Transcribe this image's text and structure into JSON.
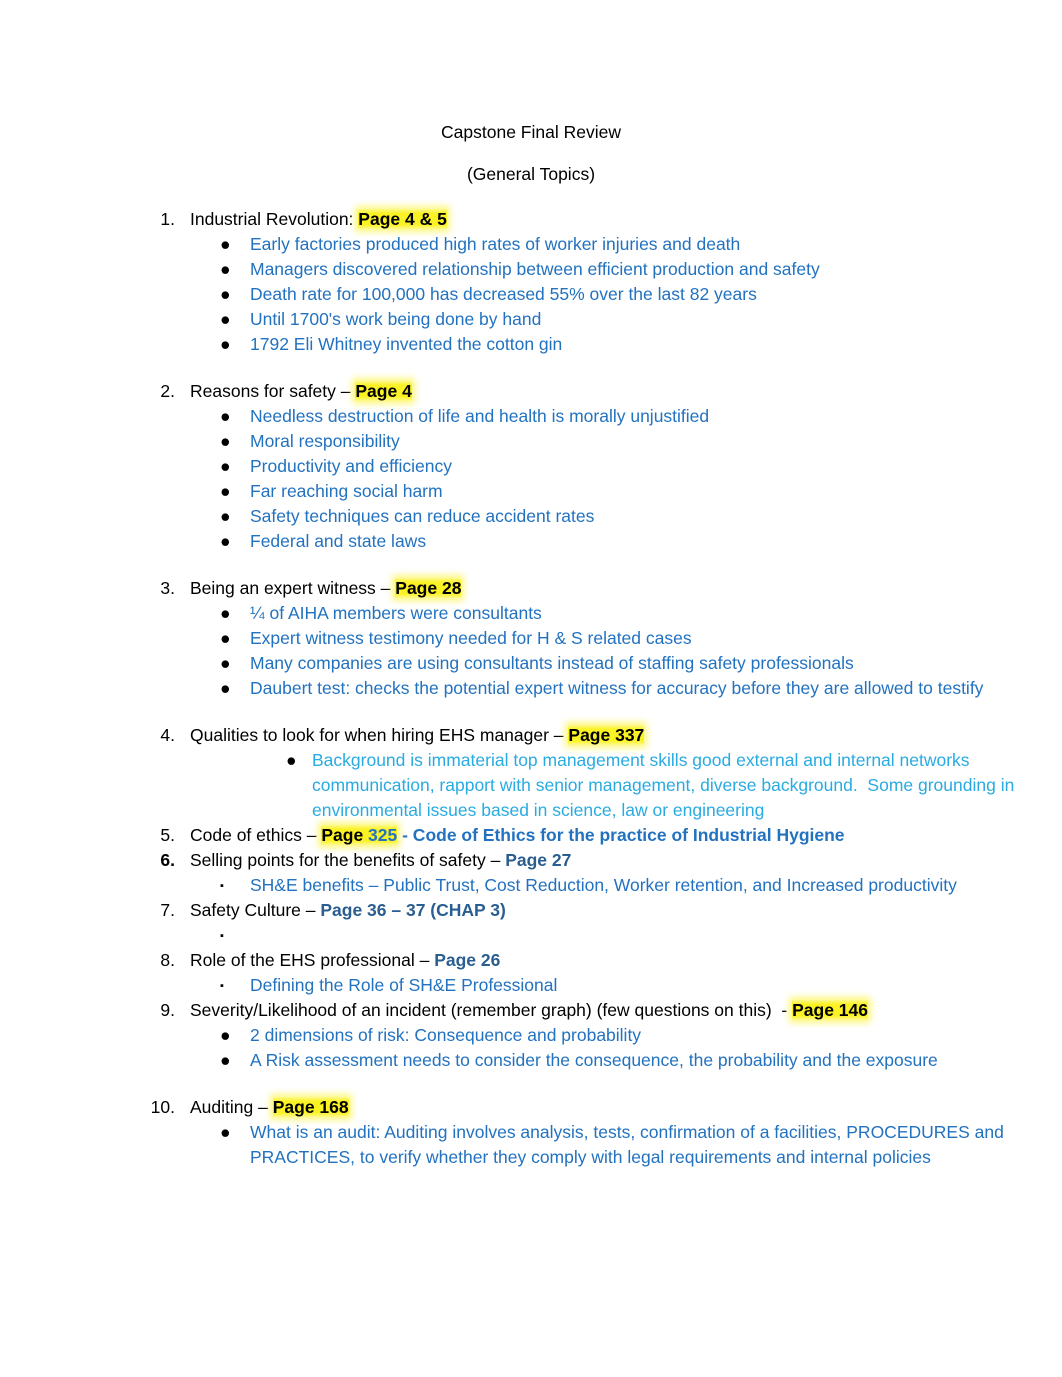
{
  "document": {
    "title": "Capstone Final Review",
    "subtitle": "(General Topics)"
  },
  "colors": {
    "body_text": "#000000",
    "bullet_blue": "#2272C0",
    "bullet_cyan": "#29ABE2",
    "page_ref_navy": "#2A5D90",
    "highlight_yellow": "#FBF32B"
  },
  "items": [
    {
      "number": "1.",
      "title": "Industrial Revolution:",
      "page_ref": "Page 4 & 5",
      "bullets": [
        "Early factories produced high rates of worker injuries and death",
        "Managers discovered relationship between efficient production and safety",
        "Death rate for 100,000 has decreased 55% over the last 82 years",
        "Until 1700's work being done by hand",
        "1792 Eli Whitney invented the cotton gin"
      ]
    },
    {
      "number": "2.",
      "title": "Reasons for safety –",
      "page_ref": "Page 4",
      "bullets": [
        "Needless destruction of life and health is morally unjustified",
        "Moral responsibility",
        "Productivity and efficiency",
        "Far reaching social harm",
        "Safety techniques can reduce accident rates",
        "Federal and state laws"
      ]
    },
    {
      "number": "3.",
      "title": "Being an expert witness –",
      "page_ref": "Page 28",
      "bullets": [
        "¼ of AIHA members were consultants",
        "Expert witness testimony needed for H & S related cases",
        "Many companies are using consultants instead of staffing safety professionals",
        "Daubert test: checks the potential expert witness for accuracy before they are allowed to testify"
      ]
    },
    {
      "number": "4.",
      "title": "Qualities to look for when hiring EHS manager –",
      "page_ref": "Page 337",
      "bullets": [
        "Background is immaterial top management skills good external and internal networks communication, rapport with senior management, diverse background.  Some grounding in environmental issues based in science, law or engineering"
      ]
    },
    {
      "number": "5.",
      "title": "Code of ethics –",
      "page_word": "Page",
      "page_number": "325",
      "page_suffix": " - Code of Ethics for the practice of Industrial Hygiene",
      "bullets": []
    },
    {
      "number": "6.",
      "title": "Selling points for the benefits of safety –",
      "page_ref": "Page 27",
      "bullets": [
        "SH&E benefits – Public Trust, Cost Reduction, Worker retention, and Increased productivity"
      ]
    },
    {
      "number": "7.",
      "title": "Safety Culture –",
      "page_ref": "Page 36 – 37 (CHAP 3)",
      "bullets": [
        ""
      ]
    },
    {
      "number": "8.",
      "title": "Role of the EHS professional –",
      "page_ref": "Page 26",
      "bullets": [
        "Defining the Role of SH&E Professional"
      ]
    },
    {
      "number": "9.",
      "title": "Severity/Likelihood of an incident (remember graph) (few questions on this)  -",
      "page_ref": "Page 146",
      "bullets": [
        "2 dimensions of risk: Consequence and probability",
        "A Risk assessment needs to consider the consequence, the probability and the exposure"
      ]
    },
    {
      "number": "10.",
      "title": "Auditing –",
      "page_ref": "Page 168",
      "bullets": [
        "What is an audit: Auditing involves analysis, tests, confirmation of a facilities, PROCEDURES and PRACTICES, to verify whether they comply with legal requirements and internal policies"
      ]
    }
  ],
  "bullet_glyphs": {
    "round": "●",
    "square": "▪"
  }
}
